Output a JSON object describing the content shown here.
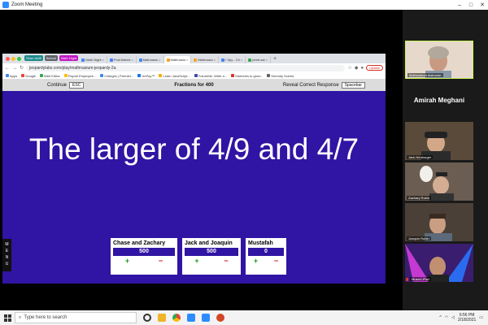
{
  "zoom": {
    "title": "Zoom Meeting",
    "controls": [
      "–",
      "□",
      "✕"
    ]
  },
  "browser": {
    "chips": [
      {
        "label": "Shun stUff",
        "color": "#1b8a8a"
      },
      {
        "label": "School",
        "color": "#5f6368"
      },
      {
        "label": "Math Night",
        "color": "#c218c2"
      }
    ],
    "tabs": [
      {
        "label": "Math Night",
        "active": false
      },
      {
        "label": "Post Attend",
        "active": false
      },
      {
        "label": "Mathnasiu",
        "active": false
      },
      {
        "label": "Mathnasiu",
        "active": true
      },
      {
        "label": "Mathnasiu",
        "active": false
      },
      {
        "label": "I Spy - Ch",
        "active": false
      },
      {
        "label": "pbmt sat",
        "active": false
      }
    ],
    "url": "jeopardylabs.com/play/mathnasium-jeopardy-2a",
    "update_label": "Update",
    "bookmarks": [
      {
        "label": "Apps",
        "color": "#4285f4"
      },
      {
        "label": "Google",
        "color": "#ea4335"
      },
      {
        "label": "Web Editor",
        "color": "#34a853"
      },
      {
        "label": "Payroll Employee...",
        "color": "#fbbc05"
      },
      {
        "label": "Colleges | Premier...",
        "color": "#4285f4"
      },
      {
        "label": "OnPay™",
        "color": "#1a73e8"
      },
      {
        "label": "Learn JavaScript...",
        "color": "#f9ab00"
      },
      {
        "label": "FutureMe: Write a...",
        "color": "#3949ab"
      },
      {
        "label": "Stretches to grow...",
        "color": "#d93025"
      },
      {
        "label": "Serenity Scents",
        "color": "#5f6368"
      }
    ]
  },
  "game": {
    "continue_label": "Continue",
    "continue_key": "ESC",
    "title": "Fractions for 400",
    "reveal_label": "Reveal Correct Response",
    "reveal_key": "Spacebar",
    "clue": "The larger of 4/9 and 4/7",
    "menu_letters": [
      "M",
      "E",
      "N",
      "U"
    ],
    "teams": [
      {
        "name": "Chase and Zachary",
        "score": "500"
      },
      {
        "name": "Jack and Joaquin",
        "score": "500"
      },
      {
        "name": "Mustafah",
        "score": "0"
      }
    ],
    "plus": "+",
    "minus": "−"
  },
  "gallery": {
    "instructor_label": "Mathnasium Instructor",
    "featured_name": "Amirah Meghani",
    "participants": [
      {
        "name": "Jack Neuburger",
        "bg": "#5a4a3a"
      },
      {
        "name": "Zachary Rubin",
        "bg": "#6b5d52"
      },
      {
        "name": "Joaquin Rubin",
        "bg": "#4a4038"
      },
      {
        "name": "Musa's iPad",
        "bg": "#3a1d6e"
      }
    ]
  },
  "taskbar": {
    "search_placeholder": "Type here to search",
    "time": "6:56 PM",
    "date": "2/18/2021"
  }
}
